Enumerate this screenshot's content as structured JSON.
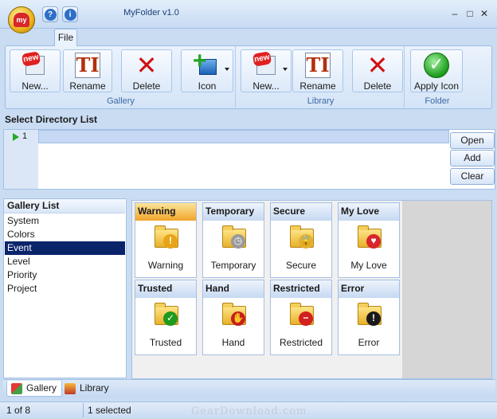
{
  "window": {
    "title": "MyFolder v1.0",
    "orb_text": "my",
    "help_glyph": "?",
    "info_glyph": "i",
    "minimize_glyph": "–",
    "maximize_glyph": "□",
    "close_glyph": "✕"
  },
  "ribbon": {
    "tab": "File",
    "groups": {
      "gallery": "Gallery",
      "library": "Library",
      "folder": "Folder"
    },
    "gallery_buttons": {
      "new": "New...",
      "rename": "Rename",
      "delete": "Delete",
      "icon": "Icon"
    },
    "library_buttons": {
      "new": "New...",
      "rename": "Rename",
      "delete": "Delete"
    },
    "folder_buttons": {
      "apply": "Apply Icon"
    },
    "icon_glyphs": {
      "new_badge": "new",
      "rename": "TI",
      "delete": "✕",
      "icon_plus": "+",
      "apply": "✓"
    }
  },
  "directory": {
    "header": "Select Directory List",
    "row_number": "1",
    "buttons": {
      "open": "Open",
      "add": "Add",
      "clear": "Clear"
    }
  },
  "gallery_list": {
    "header": "Gallery List",
    "items": [
      "System",
      "Colors",
      "Event",
      "Level",
      "Priority",
      "Project"
    ],
    "selected": "Event"
  },
  "icons": [
    {
      "title": "Warning",
      "label": "Warning",
      "badge": "!",
      "badge_color": "#e8a317",
      "selected": true
    },
    {
      "title": "Temporary",
      "label": "Temporary",
      "badge": "◷",
      "badge_color": "#9a9a9a"
    },
    {
      "title": "Secure",
      "label": "Secure",
      "badge": "🔒",
      "badge_color": "#e0b030"
    },
    {
      "title": "My Love",
      "label": "My Love",
      "badge": "♥",
      "badge_color": "#d8262b"
    },
    {
      "title": "Trusted",
      "label": "Trusted",
      "badge": "✓",
      "badge_color": "#1e9a1e"
    },
    {
      "title": "Hand",
      "label": "Hand",
      "badge": "✋",
      "badge_color": "#c81e1e"
    },
    {
      "title": "Restricted",
      "label": "Restricted",
      "badge": "−",
      "badge_color": "#d32020"
    },
    {
      "title": "Error",
      "label": "Error",
      "badge": "!",
      "badge_color": "#1a1a1a"
    }
  ],
  "bottom_tabs": {
    "gallery": "Gallery",
    "library": "Library"
  },
  "status": {
    "page": "1 of 8",
    "selection": "1 selected",
    "watermark": "GearDownload.com"
  }
}
